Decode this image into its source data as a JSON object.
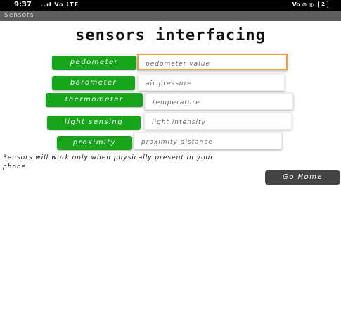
{
  "status_bar": {
    "time": "9:37",
    "signal": "..ıl Vo LTE",
    "right": "Vo ⊙ ◎",
    "battery": "2"
  },
  "app_bar": {
    "title": "Sensors"
  },
  "page": {
    "title": "sensors interfacing"
  },
  "sensors": [
    {
      "button": "pedometer",
      "placeholder": "pedometer value"
    },
    {
      "button": "barometer",
      "placeholder": "air pressure"
    },
    {
      "button": "thermometer",
      "placeholder": "temperature"
    },
    {
      "button": "light sensing",
      "placeholder": "light intensity"
    },
    {
      "button": "proximity",
      "placeholder": "proximity distance"
    }
  ],
  "note": "Sensors will work only when physically present in your phone",
  "home_button": "Go Home",
  "colors": {
    "accent_green": "#17a51b",
    "focus_orange": "#f29d38",
    "home_button": "#444444"
  }
}
